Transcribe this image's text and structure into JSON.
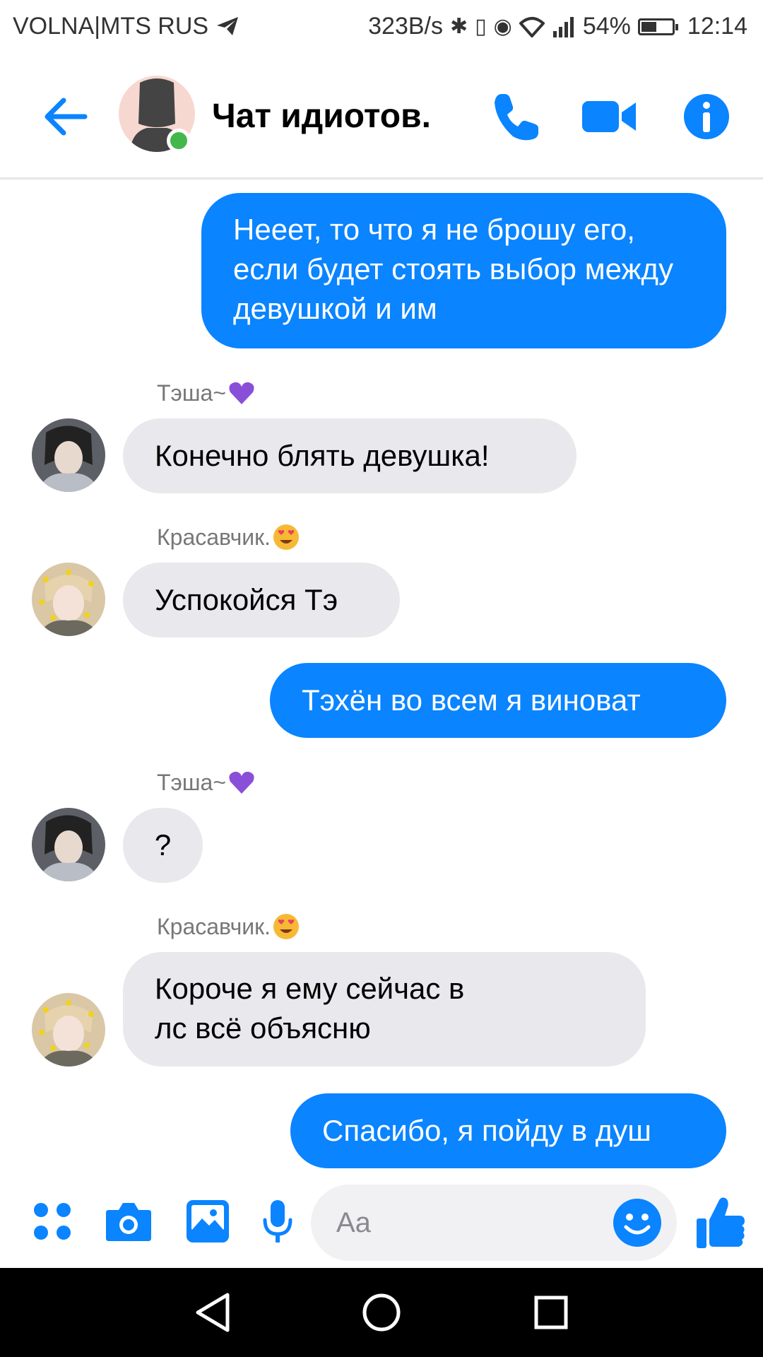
{
  "status_bar": {
    "carrier": "VOLNA|MTS RUS",
    "net_speed": "323B/s",
    "battery": "54%",
    "battery_level": 0.54,
    "time": "12:14"
  },
  "header": {
    "title": "Чат идиотов.",
    "accent": "#0a84ff",
    "online_color": "#44b74a"
  },
  "messages": [
    {
      "dir": "out",
      "text": "Нееет, то что я не брошу его, если будет стоять выбор между девушкой и им"
    },
    {
      "dir": "in",
      "sender": "Тэша~",
      "sender_emoji": "purple-heart-emoji",
      "text": "Конечно блять девушка!"
    },
    {
      "dir": "in",
      "sender": "Красавчик.",
      "sender_emoji": "heart-eyes-emoji",
      "text": "Успокойся Тэ"
    },
    {
      "dir": "out",
      "text": "Тэхён во всем я виноват"
    },
    {
      "dir": "in",
      "sender": "Тэша~",
      "sender_emoji": "purple-heart-emoji",
      "text": "?"
    },
    {
      "dir": "in",
      "sender": "Красавчик.",
      "sender_emoji": "heart-eyes-emoji",
      "text": "Короче я ему сейчас в лс всё объясню"
    },
    {
      "dir": "out",
      "text": "Спасибо, я пойду в душ"
    }
  ],
  "composer": {
    "placeholder": "Aa"
  }
}
